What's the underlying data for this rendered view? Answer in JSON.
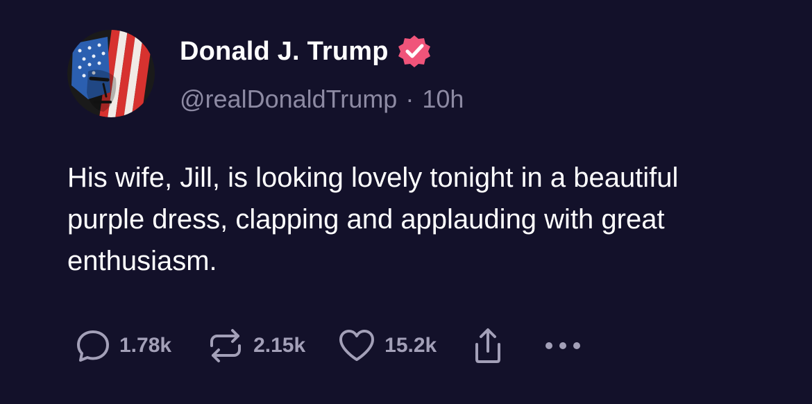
{
  "author": {
    "display_name": "Donald J. Trump",
    "handle": "@realDonaldTrump",
    "separator": "·",
    "time_ago": "10h",
    "verified": true
  },
  "post": {
    "text": "His wife, Jill, is looking lovely tonight in a beautiful purple dress, clapping and applauding with great enthusiasm."
  },
  "actions": {
    "reply_count": "1.78k",
    "repost_count": "2.15k",
    "like_count": "15.2k"
  },
  "icons": {
    "reply": "speech-bubble-icon",
    "repost": "repost-arrows-icon",
    "like": "heart-icon",
    "share": "share-upload-icon",
    "more": "more-dots-icon",
    "verified": "verified-badge-icon"
  },
  "colors": {
    "background": "#13112a",
    "text_primary": "#ffffff",
    "text_secondary": "#8d8aa3",
    "action_gray": "#a3a0b8",
    "verified_badge": "#f0547a"
  }
}
